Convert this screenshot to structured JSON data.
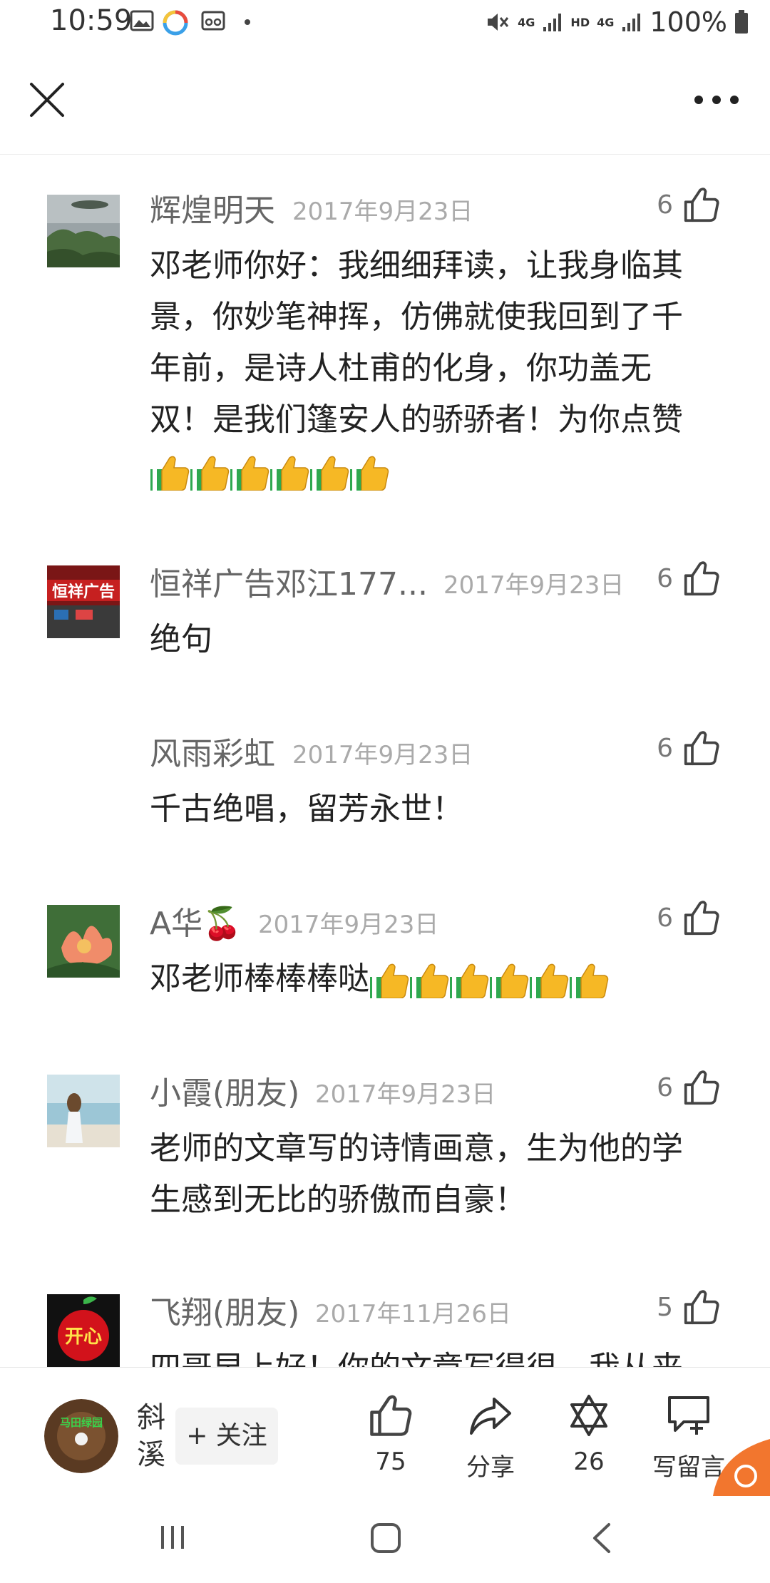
{
  "status_bar": {
    "time": "10:59",
    "network_1": "4G",
    "hd": "HD",
    "network_2": "4G",
    "battery": "100%"
  },
  "nav": {
    "close_icon": "close-icon",
    "more_icon": "more-icon"
  },
  "comments": [
    {
      "name": "辉煌明天",
      "date": "2017年9月23日",
      "likes": "6",
      "text": "邓老师你好：我细细拜读，让我身临其景，你妙笔神挥，仿佛就使我回到了千年前，是诗人杜甫的化身，你功盖无双！是我们篷安人的骄骄者！为你点赞",
      "emoji_count": 6
    },
    {
      "name": "恒祥广告邓江177...",
      "date": "2017年9月23日",
      "likes": "6",
      "text": "绝句",
      "avatar_text": "恒祥广告"
    },
    {
      "name": "风雨彩虹",
      "date": "2017年9月23日",
      "likes": "6",
      "text": "千古绝唱，留芳永世！"
    },
    {
      "name": "A华🍒",
      "date": "2017年9月23日",
      "likes": "6",
      "text": "邓老师棒棒棒哒",
      "emoji_count": 6
    },
    {
      "name": "小霞(朋友)",
      "date": "2017年9月23日",
      "likes": "6",
      "text": "老师的文章写的诗情画意，生为他的学生感到无比的骄傲而自豪！"
    },
    {
      "name": "飞翔(朋友)",
      "date": "2017年11月26日",
      "likes": "5",
      "text": "四哥早上好！你的文章写得很，我从来",
      "avatar_text": "开心"
    }
  ],
  "bottom_bar": {
    "author_name": "斜溪",
    "author_avatar_text": "马田绿园",
    "follow_label": "+ 关注",
    "like_count": "75",
    "share_label": "分享",
    "star_count": "26",
    "comment_label": "写留言"
  }
}
